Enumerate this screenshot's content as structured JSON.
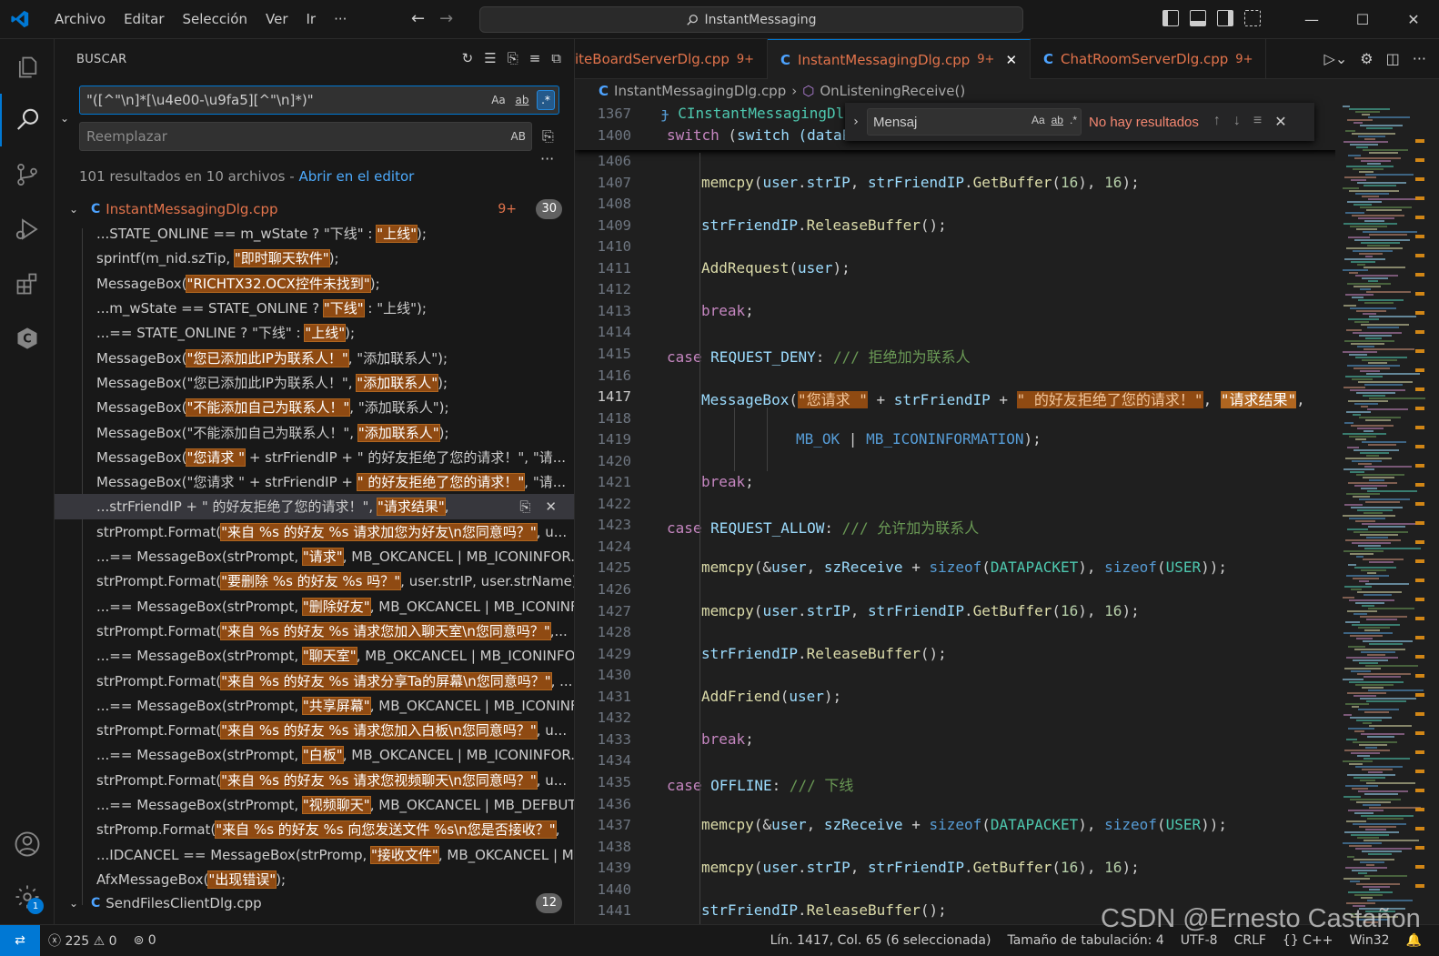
{
  "titlebar": {
    "menu": [
      "Archivo",
      "Editar",
      "Selección",
      "Ver",
      "Ir",
      "···"
    ],
    "command_center": "InstantMessaging"
  },
  "activity_bar": {
    "items": [
      "explorer-icon",
      "search-icon",
      "source-control-icon",
      "run-debug-icon",
      "extensions-icon",
      "c-cpp-icon"
    ],
    "bottom": [
      "accounts-icon",
      "manage-gear-icon"
    ],
    "manage_badge": "1"
  },
  "search": {
    "title": "BUSCAR",
    "query": "\"([^\"\\n]*[\\u4e00-\\u9fa5][^\"\\n]*)\"",
    "replace_placeholder": "Reemplazar",
    "option_case": "Aa",
    "option_word": "ab",
    "option_regex": ".*",
    "option_preserve": "AB",
    "summary": "101 resultados en 10 archivos - ",
    "open_in_editor": "Abrir en el editor",
    "file1": {
      "name": "InstantMessagingDlg.cpp",
      "problems": "9+",
      "count": "30"
    },
    "file2": {
      "name": "SendFilesClientDlg.cpp",
      "count": "12"
    },
    "results": [
      {
        "pre": "...STATE_ONLINE == m_wState ? \"下线\" : ",
        "hl": "\"上线\"",
        "post": ");"
      },
      {
        "pre": "sprintf(m_nid.szTip, ",
        "hl": "\"即时聊天软件\"",
        "post": ");"
      },
      {
        "pre": "MessageBox(",
        "hl": "\"RICHTX32.OCX控件未找到\"",
        "post": ");"
      },
      {
        "pre": "...m_wState == STATE_ONLINE ? ",
        "hl": "\"下线\"",
        "post": " : \"上线\");"
      },
      {
        "pre": "...== STATE_ONLINE ? \"下线\" : ",
        "hl": "\"上线\"",
        "post": ");"
      },
      {
        "pre": "MessageBox(",
        "hl": "\"您已添加此IP为联系人！\"",
        "post": ", \"添加联系人\");"
      },
      {
        "pre": "MessageBox(\"您已添加此IP为联系人！\", ",
        "hl": "\"添加联系人\"",
        "post": ");"
      },
      {
        "pre": "MessageBox(",
        "hl": "\"不能添加自己为联系人！\"",
        "post": ", \"添加联系人\");"
      },
      {
        "pre": "MessageBox(\"不能添加自己为联系人！\", ",
        "hl": "\"添加联系人\"",
        "post": ");"
      },
      {
        "pre": "MessageBox(",
        "hl": "\"您请求 \"",
        "post": " + strFriendIP + \" 的好友拒绝了您的请求！\", \"请..."
      },
      {
        "pre": "MessageBox(\"您请求 \" + strFriendIP + ",
        "hl": "\" 的好友拒绝了您的请求！\"",
        "post": ", \"请..."
      },
      {
        "pre": "...strFriendIP + \" 的好友拒绝了您的请求！\", ",
        "hl": "\"请求结果\"",
        "post": ","
      },
      {
        "pre": "strPrompt.Format(",
        "hl": "\"来自 %s 的好友 %s 请求加您为好友\\n您同意吗？\"",
        "post": ", u..."
      },
      {
        "pre": "...== MessageBox(strPrompt, ",
        "hl": "\"请求\"",
        "post": ", MB_OKCANCEL | MB_ICONINFOR..."
      },
      {
        "pre": "strPrompt.Format(",
        "hl": "\"要删除 %s 的好友 %s 吗？\"",
        "post": ", user.strIP, user.strName);"
      },
      {
        "pre": "...== MessageBox(strPrompt, ",
        "hl": "\"删除好友\"",
        "post": ", MB_OKCANCEL | MB_ICONINF..."
      },
      {
        "pre": "strPrompt.Format(",
        "hl": "\"来自 %s 的好友 %s 请求您加入聊天室\\n您同意吗？\"",
        "post": ",..."
      },
      {
        "pre": "...== MessageBox(strPrompt, ",
        "hl": "\"聊天室\"",
        "post": ", MB_OKCANCEL | MB_ICONINFO..."
      },
      {
        "pre": "strPrompt.Format(",
        "hl": "\"来自 %s 的好友 %s 请求分享Ta的屏幕\\n您同意吗？\"",
        "post": ", ..."
      },
      {
        "pre": "...== MessageBox(strPrompt, ",
        "hl": "\"共享屏幕\"",
        "post": ", MB_OKCANCEL | MB_ICONINF..."
      },
      {
        "pre": "strPrompt.Format(",
        "hl": "\"来自 %s 的好友 %s 请求您加入白板\\n您同意吗？\"",
        "post": ", u..."
      },
      {
        "pre": "...== MessageBox(strPrompt, ",
        "hl": "\"白板\"",
        "post": ", MB_OKCANCEL | MB_ICONINFOR..."
      },
      {
        "pre": "strPrompt.Format(",
        "hl": "\"来自 %s 的好友 %s 请求您视频聊天\\n您同意吗？\"",
        "post": ", u..."
      },
      {
        "pre": "...== MessageBox(strPrompt, ",
        "hl": "\"视频聊天\"",
        "post": ", MB_OKCANCEL | MB_DEFBUTT..."
      },
      {
        "pre": "strPromp.Format(",
        "hl": "\"来自 %s 的好友 %s 向您发送文件 %s\\n您是否接收？\"",
        "post": ","
      },
      {
        "pre": "...IDCANCEL == MessageBox(strPromp, ",
        "hl": "\"接收文件\"",
        "post": ", MB_OKCANCEL | M..."
      },
      {
        "pre": "AfxMessageBox(",
        "hl": "\"出现错误\"",
        "post": ");"
      }
    ]
  },
  "tabs": [
    {
      "label": "iteBoardServerDlg.cpp",
      "badge": "9+",
      "active": false
    },
    {
      "label": "InstantMessagingDlg.cpp",
      "badge": "9+",
      "active": true
    },
    {
      "label": "ChatRoomServerDlg.cpp",
      "badge": "9+",
      "active": false
    }
  ],
  "breadcrumb": {
    "file": "InstantMessagingDlg.cpp",
    "symbol": "OnListeningReceive()"
  },
  "find_widget": {
    "value": "Mensaj",
    "opt_case": "Aa",
    "opt_word": "ab",
    "opt_regex": ".*",
    "result": "No hay resultados"
  },
  "editor": {
    "sticky": [
      {
        "ln": "1367",
        "text": "CInstantMessagingDl"
      },
      {
        "ln": "1400",
        "text": "switch (dataPacket.c"
      }
    ],
    "line_numbers": [
      "1406",
      "1407",
      "1408",
      "1409",
      "1410",
      "1411",
      "1412",
      "1413",
      "1414",
      "1415",
      "1416",
      "1417",
      "1418",
      "1419",
      "1420",
      "1421",
      "1422",
      "1423",
      "1424",
      "1425",
      "1426",
      "1427",
      "1428",
      "1429",
      "1430",
      "1431",
      "1432",
      "1433",
      "1434",
      "1435",
      "1436",
      "1437",
      "1438",
      "1439",
      "1440",
      "1441"
    ],
    "current_line": "1417",
    "code": {
      "l1407": [
        "memcpy",
        "(",
        "user",
        ".",
        "strIP",
        ", ",
        "strFriendIP",
        ".",
        "GetBuffer",
        "(",
        "16",
        "), ",
        "16",
        ");"
      ],
      "l1409": [
        "strFriendIP",
        ".",
        "ReleaseBuffer",
        "();"
      ],
      "l1411": [
        "AddRequest",
        "(",
        "user",
        ");"
      ],
      "l1413": "break;",
      "l1415": [
        "case ",
        "REQUEST_DENY",
        ": ",
        "/// 拒绝加为联系人"
      ],
      "l1417": [
        "MessageBox",
        "(",
        "\"您请求 \"",
        " + ",
        "strFriendIP",
        " + ",
        "\" 的好友拒绝了您的请求！\"",
        ", ",
        "\"请求结果\"",
        ","
      ],
      "l1419": [
        "MB_OK",
        " | ",
        "MB_ICONINFORMATION",
        ");"
      ],
      "l1421": "break;",
      "l1423": [
        "case ",
        "REQUEST_ALLOW",
        ": ",
        "/// 允许加为联系人"
      ],
      "l1425": [
        "memcpy",
        "(&",
        "user",
        ", ",
        "szReceive",
        " + ",
        "sizeof",
        "(",
        "DATAPACKET",
        "), ",
        "sizeof",
        "(",
        "USER",
        "));"
      ],
      "l1427": [
        "memcpy",
        "(",
        "user",
        ".",
        "strIP",
        ", ",
        "strFriendIP",
        ".",
        "GetBuffer",
        "(",
        "16",
        "), ",
        "16",
        ");"
      ],
      "l1429": [
        "strFriendIP",
        ".",
        "ReleaseBuffer",
        "();"
      ],
      "l1431": [
        "AddFriend",
        "(",
        "user",
        ");"
      ],
      "l1433": "break;",
      "l1435": [
        "case ",
        "OFFLINE",
        ": ",
        "/// 下线"
      ],
      "l1437": [
        "memcpy",
        "(&",
        "user",
        ", ",
        "szReceive",
        " + ",
        "sizeof",
        "(",
        "DATAPACKET",
        "), ",
        "sizeof",
        "(",
        "USER",
        "));"
      ],
      "l1439": [
        "memcpy",
        "(",
        "user",
        ".",
        "strIP",
        ", ",
        "strFriendIP",
        ".",
        "GetBuffer",
        "(",
        "16",
        "), ",
        "16",
        ");"
      ],
      "l1441": [
        "strFriendIP",
        ".",
        "ReleaseBuffer",
        "();"
      ]
    }
  },
  "statusbar": {
    "errors": "225",
    "warnings": "0",
    "ports": "0",
    "position": "Lín. 1417, Col. 65 (6 seleccionada)",
    "tab_size": "Tamaño de tabulación: 4",
    "encoding": "UTF-8",
    "eol": "CRLF",
    "language": "{} C++",
    "platform": "Win32"
  },
  "watermark": "CSDN @Ernesto Castañon",
  "colors": {
    "accent": "#0078d4",
    "match_bg": "#8f4a12",
    "string": "#ce9178",
    "keyword": "#c586c0",
    "function": "#dcdcaa",
    "variable": "#9cdcfe"
  }
}
